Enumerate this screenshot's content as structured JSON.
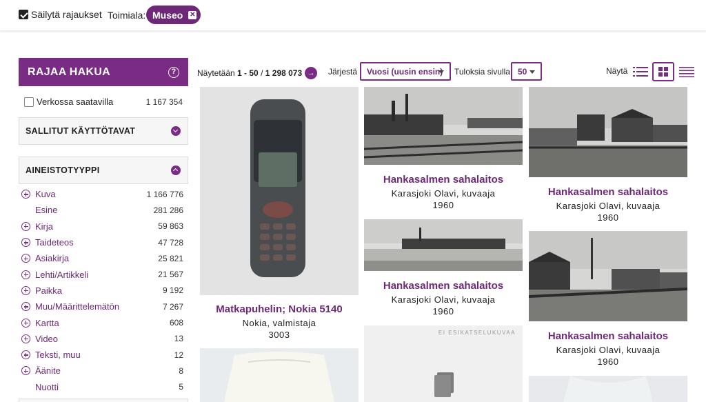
{
  "topbar": {
    "keep_filters_label": "Säilytä rajaukset",
    "industry_label": "Toimiala:",
    "industry_chip": "Museo"
  },
  "sidebar": {
    "title": "RAJAA HAKUA",
    "online": {
      "label": "Verkossa saatavilla",
      "count": "1 167 354"
    },
    "panels": {
      "usage": "SALLITUT KÄYTTÖTAVAT",
      "type": "AINEISTOTYYPPI"
    },
    "facets": [
      {
        "name": "Kuva",
        "count": "1 166 776",
        "expandable": true
      },
      {
        "name": "Esine",
        "count": "281 286",
        "expandable": false
      },
      {
        "name": "Kirja",
        "count": "59 863",
        "expandable": true
      },
      {
        "name": "Taideteos",
        "count": "47 728",
        "expandable": true
      },
      {
        "name": "Asiakirja",
        "count": "25 821",
        "expandable": true
      },
      {
        "name": "Lehti/Artikkeli",
        "count": "21 567",
        "expandable": true
      },
      {
        "name": "Paikka",
        "count": "9 192",
        "expandable": true
      },
      {
        "name": "Muu/Määrittelemätön",
        "count": "7 267",
        "expandable": true
      },
      {
        "name": "Kartta",
        "count": "608",
        "expandable": true
      },
      {
        "name": "Video",
        "count": "13",
        "expandable": true
      },
      {
        "name": "Teksti, muu",
        "count": "12",
        "expandable": true
      },
      {
        "name": "Äänite",
        "count": "8",
        "expandable": true
      },
      {
        "name": "Nuotti",
        "count": "5",
        "expandable": false
      }
    ]
  },
  "toolbar": {
    "showing_prefix": "Näytetään",
    "range": "1 - 50",
    "separator": "/",
    "total": "1 298 073",
    "sort_label": "Järjestä",
    "sort_value": "Vuosi (uusin ensin)",
    "per_page_label": "Tuloksia sivulla",
    "per_page_value": "50",
    "view_label": "Näytä"
  },
  "results": [
    {
      "title": "Matkapuhelin; Nokia 5140",
      "author": "Nokia, valmistaja",
      "year": "3003"
    },
    {
      "title": "Hankasalmen sahalaitos",
      "author": "Karasjoki Olavi, kuvaaja",
      "year": "1960"
    },
    {
      "title": "Hankasalmen sahalaitos",
      "author": "Karasjoki Olavi, kuvaaja",
      "year": "1960"
    },
    {
      "title": "Hankasalmen sahalaitos",
      "author": "Karasjoki Olavi, kuvaaja",
      "year": "1960"
    },
    {
      "title": "Hankasalmen sahalaitos",
      "author": "Karasjoki Olavi, kuvaaja",
      "year": "1960"
    }
  ],
  "no_preview_text": "EI ESIKATSELUKUVAA",
  "colors": {
    "accent": "#7a2c85",
    "link": "#6d2977"
  }
}
